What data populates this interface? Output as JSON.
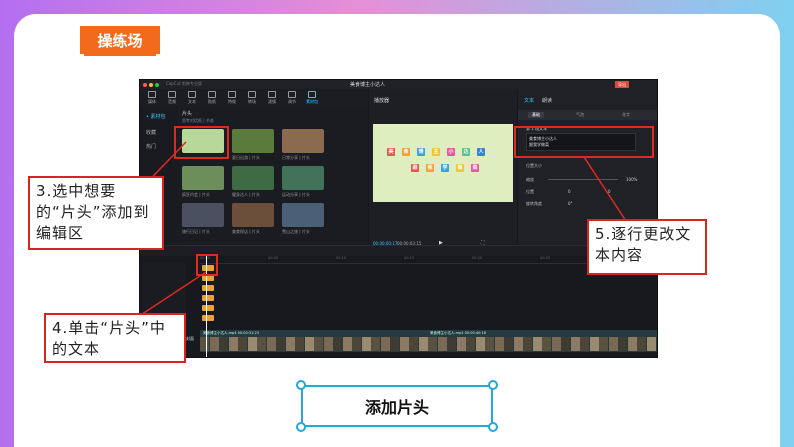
{
  "header": {
    "tag": "操练场"
  },
  "app": {
    "name": "CapCut 剪映专业版",
    "project_title": "美食博主小达人",
    "export_label": "导出",
    "toolbar": [
      "媒体",
      "音频",
      "文本",
      "贴纸",
      "特效",
      "转场",
      "滤镜",
      "调节",
      "素材包"
    ],
    "left_nav": [
      "• 素材包",
      "收藏",
      "热门"
    ],
    "media": {
      "header": "片头",
      "subtitle": "思考对话框 | 节态",
      "thumbs": [
        {
          "label": "",
          "bg": "#b8d89a"
        },
        {
          "label": "夏日出游 | 片头",
          "bg": "#5a7b3b"
        },
        {
          "label": "日常分享 | 片头",
          "bg": "#8a6b50"
        },
        {
          "label": "疯狂约会 | 片头",
          "bg": "#6b8e5a"
        },
        {
          "label": "健身达人 | 片头",
          "bg": "#3f6b44"
        },
        {
          "label": "运动分享 | 片头",
          "bg": "#41725a"
        },
        {
          "label": "旅行日记 | 片头",
          "bg": "#4a5060"
        },
        {
          "label": "美食探店 | 片头",
          "bg": "#6b4f3a"
        },
        {
          "label": "雪山之旅 | 片头",
          "bg": "#4b5f76"
        }
      ]
    },
    "player": {
      "header": "播放器",
      "time_current": "00:00:00:17",
      "time_total": "00:00:03:15",
      "preview_tiles": [
        "美",
        "食",
        "博",
        "主",
        "小",
        "达",
        "人",
        "跟",
        "我",
        "学",
        "做",
        "菜"
      ]
    },
    "props": {
      "tabs": [
        "文本",
        "朗读"
      ],
      "sub_tabs": [
        "基础",
        "气泡",
        "花字"
      ],
      "text_label": "第 1 段文本",
      "text_value_line1": "美食博主小达人",
      "text_value_line2": "跟我学做菜",
      "section": "位置大小",
      "scale_label": "缩放",
      "scale_value": "100%",
      "pos_label": "位置",
      "pos_x": "0",
      "pos_y": "0",
      "rot_label": "旋转角度",
      "rot_value": "0°"
    },
    "timeline": {
      "ruler": [
        "00:00",
        "00:05",
        "00:10",
        "00:15",
        "00:20",
        "00:25",
        "00:30"
      ],
      "video_clip_label": "美食博主小达人.mp4  00:00:31:23",
      "video_clip2_label": "美食博主小达人.mp4  00:00:40:18",
      "cover_label": "封面"
    }
  },
  "callouts": {
    "step3": "3.选中想要的“片头”添加到编辑区",
    "step4": "4.单击“片头”中的文本",
    "step5": "5.逐行更改文本内容"
  },
  "caption": "添加片头",
  "colors": {
    "accent": "#f26a1b",
    "highlight": "#e0291f",
    "cyan": "#29a6d8"
  }
}
